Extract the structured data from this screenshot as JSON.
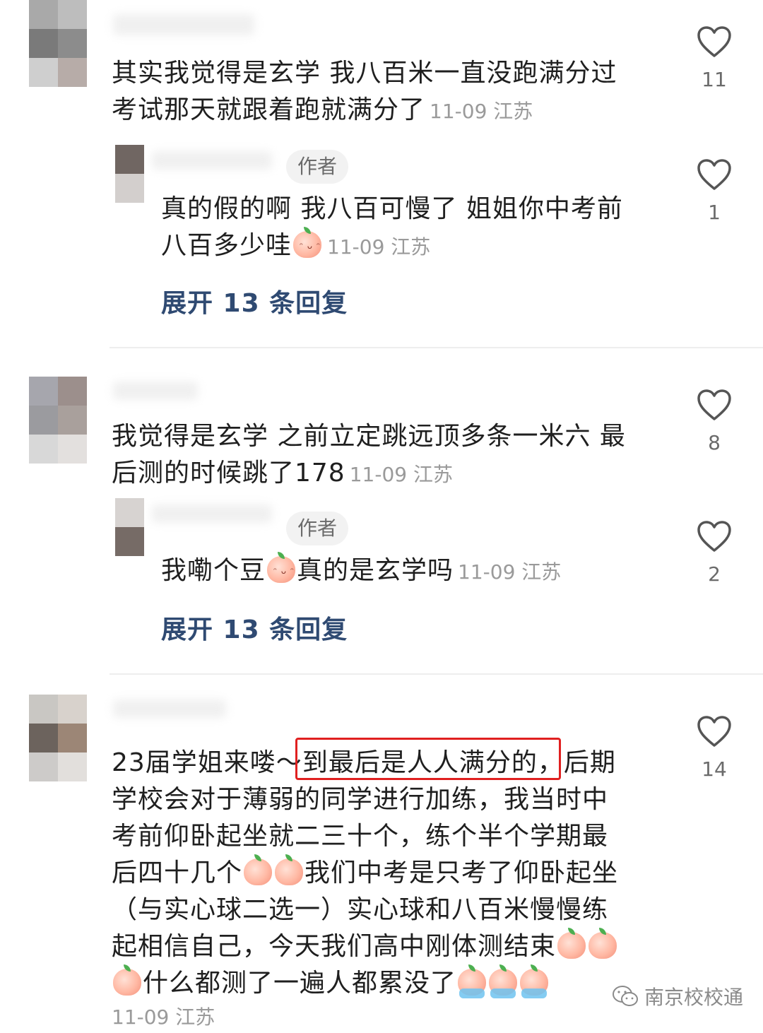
{
  "comments": [
    {
      "text_line1": "其实我觉得是玄学 我八百米一直没跑满分过",
      "text_line2": "考试那天就跟着跑就满分了",
      "meta": "11-09 江苏",
      "likes": "11"
    },
    {
      "author_badge": "作者",
      "text_line1": "真的假的啊  我八百可慢了  姐姐你中考前",
      "text_line2": "八百多少哇",
      "meta": "11-09 江苏",
      "likes": "1",
      "expand": "展开 13 条回复"
    },
    {
      "text_line1": "我觉得是玄学 之前立定跳远顶多条一米六 最",
      "text_line2": "后测的时候跳了178",
      "meta": "11-09 江苏",
      "likes": "8"
    },
    {
      "author_badge": "作者",
      "text_a": "我嘞个豆",
      "text_b": "真的是玄学吗",
      "meta": "11-09 江苏",
      "likes": "2",
      "expand": "展开 13 条回复"
    },
    {
      "line1_a": "23届学姐来喽～",
      "line1_highlight": "到最后是人人满分的",
      "line1_b": "，后期",
      "line2": "学校会对于薄弱的同学进行加练，我当时中",
      "line3": "考前仰卧起坐就二三十个，练个半个学期最",
      "line4_a": "后四十几个",
      "line4_b": "我们中考是只考了仰卧起坐",
      "line5": "（与实心球二选一）实心球和八百米慢慢练",
      "line6": "起相信自己，今天我们高中刚体测结束",
      "line7": "什么都测了一遍人都累没了",
      "meta": "11-09 江苏",
      "likes": "14"
    }
  ],
  "icons": {
    "like": "heart-outline-icon",
    "emoji": "peach-emoji-icon",
    "cry": "crying-peach-emoji-icon",
    "wechat": "wechat-icon"
  },
  "watermark": "南京校校通",
  "colors": {
    "link": "#2f4a72",
    "meta": "#9a9a9a",
    "highlight": "#e02020"
  }
}
